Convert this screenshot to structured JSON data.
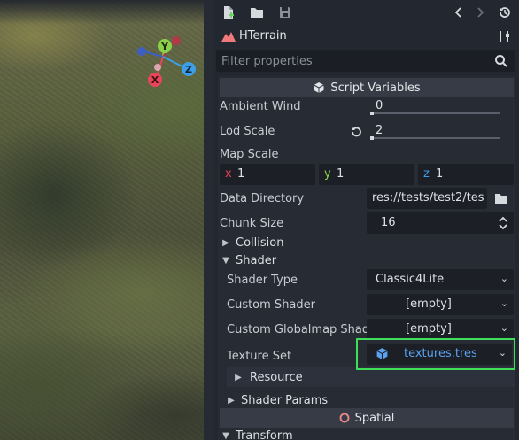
{
  "inspector": {
    "node_name": "HTerrain",
    "filter_placeholder": "Filter properties"
  },
  "sections": {
    "script_variables": "Script Variables",
    "spatial": "Spatial"
  },
  "properties": {
    "ambient_wind": {
      "label": "Ambient Wind",
      "value": "0"
    },
    "lod_scale": {
      "label": "Lod Scale",
      "value": "2"
    },
    "map_scale": {
      "label": "Map Scale",
      "x_axis": "x",
      "x": "1",
      "y_axis": "y",
      "y": "1",
      "z_axis": "z",
      "z": "1"
    },
    "data_directory": {
      "label": "Data Directory",
      "value": "res://tests/test2/tes"
    },
    "chunk_size": {
      "label": "Chunk Size",
      "value": "16"
    }
  },
  "categories": {
    "collision": "Collision",
    "shader": "Shader",
    "transform": "Transform"
  },
  "shader": {
    "shader_type": {
      "label": "Shader Type",
      "value": "Classic4Lite"
    },
    "custom_shader": {
      "label": "Custom Shader",
      "value": "[empty]"
    },
    "custom_globalmap_shader": {
      "label": "Custom Globalmap Shade",
      "value": "[empty]"
    },
    "texture_set": {
      "label": "Texture Set",
      "value": "textures.tres"
    },
    "resource": "Resource",
    "shader_params": "Shader Params"
  },
  "colors": {
    "axis_x": "#e8455a",
    "axis_y": "#8ad04a",
    "axis_z": "#3d9ee8",
    "resource_link": "#5aa2f0",
    "highlight": "#3ee05a"
  },
  "gizmo": {
    "y_label": "Y",
    "z_label": "Z",
    "x_label": "X"
  }
}
